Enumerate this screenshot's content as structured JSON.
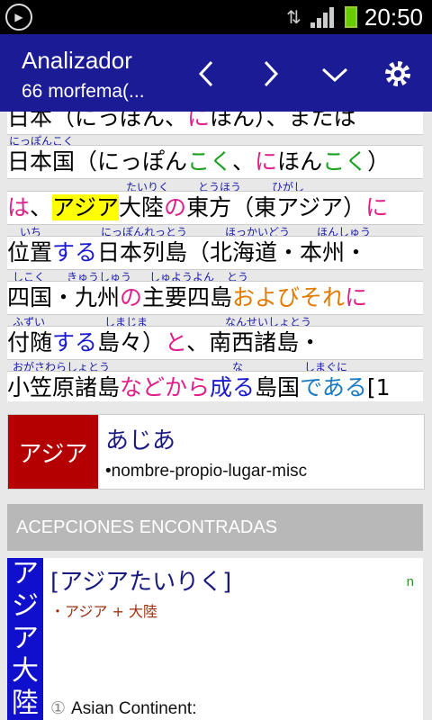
{
  "status_bar": {
    "time": "20:50"
  },
  "action_bar": {
    "title": "Analizador",
    "subtitle": "66 morfema(..."
  },
  "text_lines": [
    {
      "segments": [
        {
          "text": "日本（にっぽん、",
          "color": "black"
        },
        {
          "text": "に",
          "color": "pink"
        },
        {
          "text": "ほん）、または",
          "color": "black"
        }
      ]
    },
    {
      "segments": [
        {
          "text": "日本国（にっぽん",
          "color": "black"
        },
        {
          "text": "こく",
          "color": "green"
        },
        {
          "text": "、",
          "color": "black"
        },
        {
          "text": "に",
          "color": "pink"
        },
        {
          "text": "ほん",
          "color": "black"
        },
        {
          "text": "こく",
          "color": "green"
        },
        {
          "text": "）",
          "color": "black"
        }
      ]
    },
    {
      "segments": [
        {
          "text": "は",
          "color": "pink"
        },
        {
          "text": "、",
          "color": "black"
        },
        {
          "text": "アジア",
          "color": "black",
          "highlight": true
        },
        {
          "text": "大陸",
          "color": "black"
        },
        {
          "text": "の",
          "color": "pink"
        },
        {
          "text": "東方（東アジア）",
          "color": "black"
        },
        {
          "text": "に",
          "color": "pink"
        }
      ]
    },
    {
      "segments": [
        {
          "text": "位置",
          "color": "black"
        },
        {
          "text": "する",
          "color": "blue"
        },
        {
          "text": "日本列島（北海道・本州・",
          "color": "black"
        }
      ]
    },
    {
      "segments": [
        {
          "text": "四国・九州",
          "color": "black"
        },
        {
          "text": "の",
          "color": "pink"
        },
        {
          "text": "主要四島",
          "color": "black"
        },
        {
          "text": "および",
          "color": "orange"
        },
        {
          "text": "それ",
          "color": "orange"
        },
        {
          "text": "に",
          "color": "pink"
        }
      ]
    },
    {
      "segments": [
        {
          "text": "付随",
          "color": "black"
        },
        {
          "text": "する",
          "color": "blue"
        },
        {
          "text": "島々）",
          "color": "black"
        },
        {
          "text": "と",
          "color": "pink"
        },
        {
          "text": "、南西諸島・",
          "color": "black"
        }
      ]
    },
    {
      "segments": [
        {
          "text": "小笠原諸島",
          "color": "black"
        },
        {
          "text": "などから",
          "color": "pink"
        },
        {
          "text": "成る",
          "color": "blue"
        },
        {
          "text": "島国",
          "color": "black"
        },
        {
          "text": "である",
          "color": "teal"
        },
        {
          "text": "[1",
          "color": "black"
        }
      ]
    }
  ],
  "furigana": [
    {
      "items": [
        "にっぽんこく"
      ]
    },
    {
      "items": [
        "たいりく",
        "とうほう",
        "ひがし"
      ]
    },
    {
      "items": [
        "いち",
        "にっぽんれっとう",
        "ほっかいどう",
        "ほんしゅう"
      ]
    },
    {
      "items": [
        "しこく",
        "きゅうしゅう",
        "しゅようよん",
        "とう"
      ]
    },
    {
      "items": [
        "ふずい",
        "しまじま",
        "なんせいしょとう"
      ]
    },
    {
      "items": [
        "おがさわらしょとう",
        "な",
        "しまぐに"
      ]
    }
  ],
  "entry": {
    "word": "アジア",
    "reading": "あじあ",
    "tags": "•nombre-propio-lugar-misc"
  },
  "section_header": "ACEPCIONES ENCONTRADAS",
  "sense": {
    "side_text": "アジア大陸",
    "headword": "[アジアたいりく]",
    "pos": "n",
    "components": "・アジア + 大陸",
    "def_number": "①",
    "definition": "Asian Continent:"
  },
  "colors": {
    "action_bar": "#1b1b95",
    "blue": "#1a1ad0",
    "pink": "#e0208a",
    "green": "#18a020",
    "orange": "#e07a00",
    "teal": "#1a7ac0",
    "highlight": "#ffff00",
    "entry_word_bg": "#b40000",
    "sense_side_bg": "#1010cc"
  },
  "icons": [
    "notification-icon",
    "wifi-icon",
    "signal-icon",
    "battery-icon",
    "chevron-left-icon",
    "chevron-right-icon",
    "chevron-down-icon",
    "gear-icon"
  ]
}
